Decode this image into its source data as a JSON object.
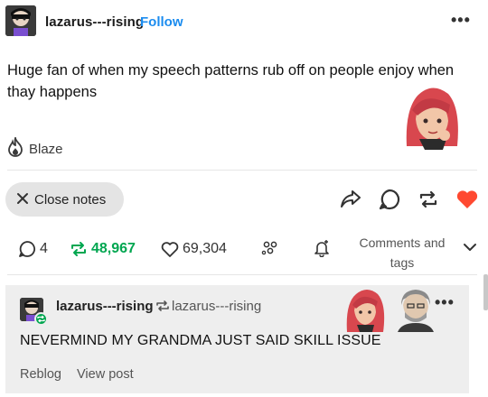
{
  "post": {
    "username": "lazarus---rising",
    "follow_label": "Follow",
    "more_label": "•••",
    "body": "Huge fan of when my speech patterns rub off on people enjoy when thay happens",
    "blaze_label": "Blaze"
  },
  "actions": {
    "close_notes_label": "Close notes",
    "share_icon": "share-icon",
    "reply_icon": "reply-icon",
    "reblog_icon": "reblog-icon",
    "like_icon": "heart-icon",
    "like_color": "#ff4930"
  },
  "notes": {
    "replies_count": "4",
    "reblogs_count": "48,967",
    "likes_count": "69,304",
    "comments_tags_line1": "Comments and",
    "comments_tags_line2": "tags",
    "reblog_color": "#00a650"
  },
  "reblog": {
    "username": "lazarus---rising",
    "reblogged_from": "lazarus---rising",
    "more_label": "•••",
    "body": "NEVERMIND MY GRANDMA JUST SAID SKILL ISSUE",
    "reblog_label": "Reblog",
    "view_post_label": "View post"
  },
  "colors": {
    "accent_blue": "#1b8cef",
    "pill_bg": "#e4e4e4",
    "card_bg": "#eeeeee"
  }
}
